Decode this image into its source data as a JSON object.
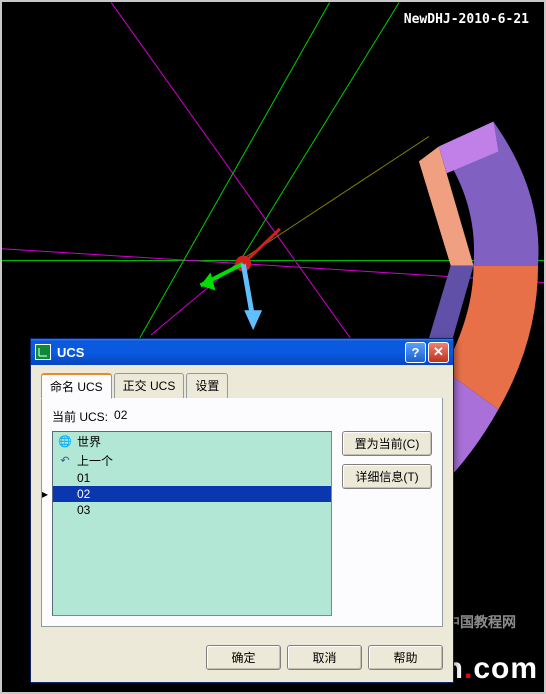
{
  "watermarks": {
    "date": "NewDHJ-2010-6-21",
    "site_cn": "中国教程网",
    "site_en_pre": "JCWcn",
    "site_en_dot": ".",
    "site_en_post": "com"
  },
  "dialog": {
    "title": "UCS",
    "tabs": {
      "named": "命名 UCS",
      "ortho": "正交 UCS",
      "settings": "设置"
    },
    "current_prefix": "当前 UCS:",
    "current_value": "02",
    "list": {
      "world": "世界",
      "previous": "上一个",
      "item1": "01",
      "item2": "02",
      "item3": "03"
    },
    "side": {
      "set_current": "置为当前(C)",
      "details": "详细信息(T)"
    },
    "footer": {
      "ok": "确定",
      "cancel": "取消",
      "help": "帮助"
    }
  }
}
